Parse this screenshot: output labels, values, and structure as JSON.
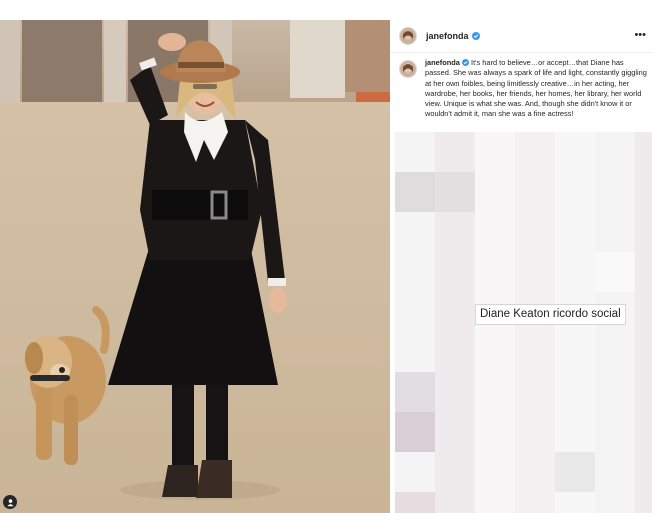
{
  "post": {
    "username": "janefonda",
    "caption_username": "janefonda",
    "caption_text": "It's hard to believe…or accept…that Diane has passed. She was always a spark of life and light, constantly giggling at her own foibles, being limitlessly creative…in her acting, her wardrobe, her books, her friends, her homes, her library, her world view. Unique is what she was. And, though she didn't know it or wouldn't admit it, man she was a fine actress!",
    "more_label": "•••",
    "verified_color": "#3897f0"
  },
  "icons": {
    "verified": "verified-badge-icon",
    "more": "more-options-icon",
    "user_tag": "user-tag-icon"
  },
  "watermark": {
    "text": "Diane Keaton ricordo social"
  }
}
